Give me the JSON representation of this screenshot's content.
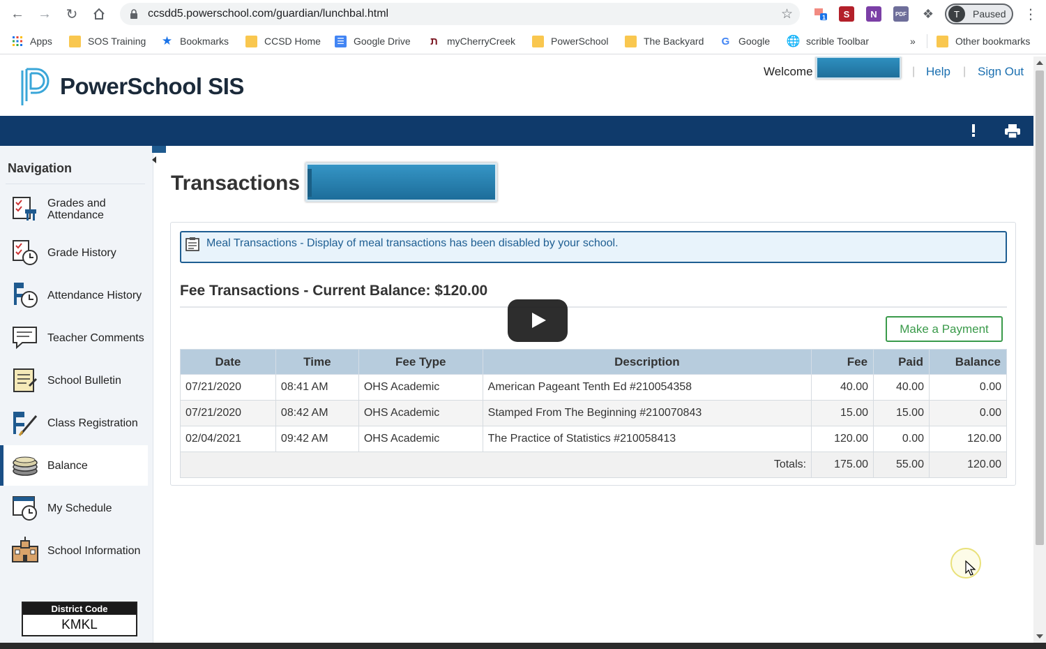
{
  "browser": {
    "url": "ccsdd5.powerschool.com/guardian/lunchbal.html",
    "profile_initial": "T",
    "profile_status": "Paused",
    "bookmarks": [
      {
        "label": "Apps",
        "icon": "apps-grid-icon"
      },
      {
        "label": "SOS Training",
        "icon": "folder-icon"
      },
      {
        "label": "Bookmarks",
        "icon": "star-icon"
      },
      {
        "label": "CCSD Home",
        "icon": "folder-icon"
      },
      {
        "label": "Google Drive",
        "icon": "docs-icon"
      },
      {
        "label": "myCherryCreek",
        "icon": "cherry-icon"
      },
      {
        "label": "PowerSchool",
        "icon": "folder-icon"
      },
      {
        "label": "The Backyard",
        "icon": "folder-icon"
      },
      {
        "label": "Google",
        "icon": "google-icon"
      },
      {
        "label": "scrible Toolbar",
        "icon": "globe-icon"
      }
    ],
    "overflow": "»",
    "other_bookmarks": "Other bookmarks"
  },
  "header": {
    "app_name": "PowerSchool SIS",
    "welcome": "Welcome",
    "help": "Help",
    "sign_out": "Sign Out",
    "separator": "|"
  },
  "sidebar": {
    "title": "Navigation",
    "items": [
      {
        "label": "Grades and Attendance",
        "icon": "grades-attendance-icon"
      },
      {
        "label": "Grade History",
        "icon": "grade-history-icon"
      },
      {
        "label": "Attendance History",
        "icon": "attendance-history-icon"
      },
      {
        "label": "Teacher Comments",
        "icon": "comments-icon"
      },
      {
        "label": "School Bulletin",
        "icon": "bulletin-icon"
      },
      {
        "label": "Class Registration",
        "icon": "registration-icon"
      },
      {
        "label": "Balance",
        "icon": "balance-coins-icon",
        "active": true
      },
      {
        "label": "My Schedule",
        "icon": "schedule-icon"
      },
      {
        "label": "School Information",
        "icon": "school-icon"
      }
    ],
    "district_code_label": "District Code",
    "district_code": "KMKL"
  },
  "main": {
    "title": "Transactions",
    "notice": "Meal Transactions - Display of meal transactions has been disabled by your school.",
    "fee_title": "Fee Transactions - Current Balance: $120.00",
    "pay_button": "Make a Payment",
    "columns": [
      "Date",
      "Time",
      "Fee Type",
      "Description",
      "Fee",
      "Paid",
      "Balance"
    ],
    "rows": [
      {
        "date": "07/21/2020",
        "time": "08:41 AM",
        "fee_type": "OHS Academic",
        "description": "American Pageant Tenth Ed #210054358",
        "fee": "40.00",
        "paid": "40.00",
        "balance": "0.00"
      },
      {
        "date": "07/21/2020",
        "time": "08:42 AM",
        "fee_type": "OHS Academic",
        "description": "Stamped From The Beginning #210070843",
        "fee": "15.00",
        "paid": "15.00",
        "balance": "0.00"
      },
      {
        "date": "02/04/2021",
        "time": "09:42 AM",
        "fee_type": "OHS Academic",
        "description": "The Practice of Statistics #210058413",
        "fee": "120.00",
        "paid": "0.00",
        "balance": "120.00"
      }
    ],
    "totals": {
      "label": "Totals:",
      "fee": "175.00",
      "paid": "55.00",
      "balance": "120.00"
    }
  },
  "colors": {
    "brand_blue": "#0f3a6b",
    "link_blue": "#1a6fb0",
    "table_header": "#b7ccdd",
    "pay_green": "#3a9a4a"
  }
}
